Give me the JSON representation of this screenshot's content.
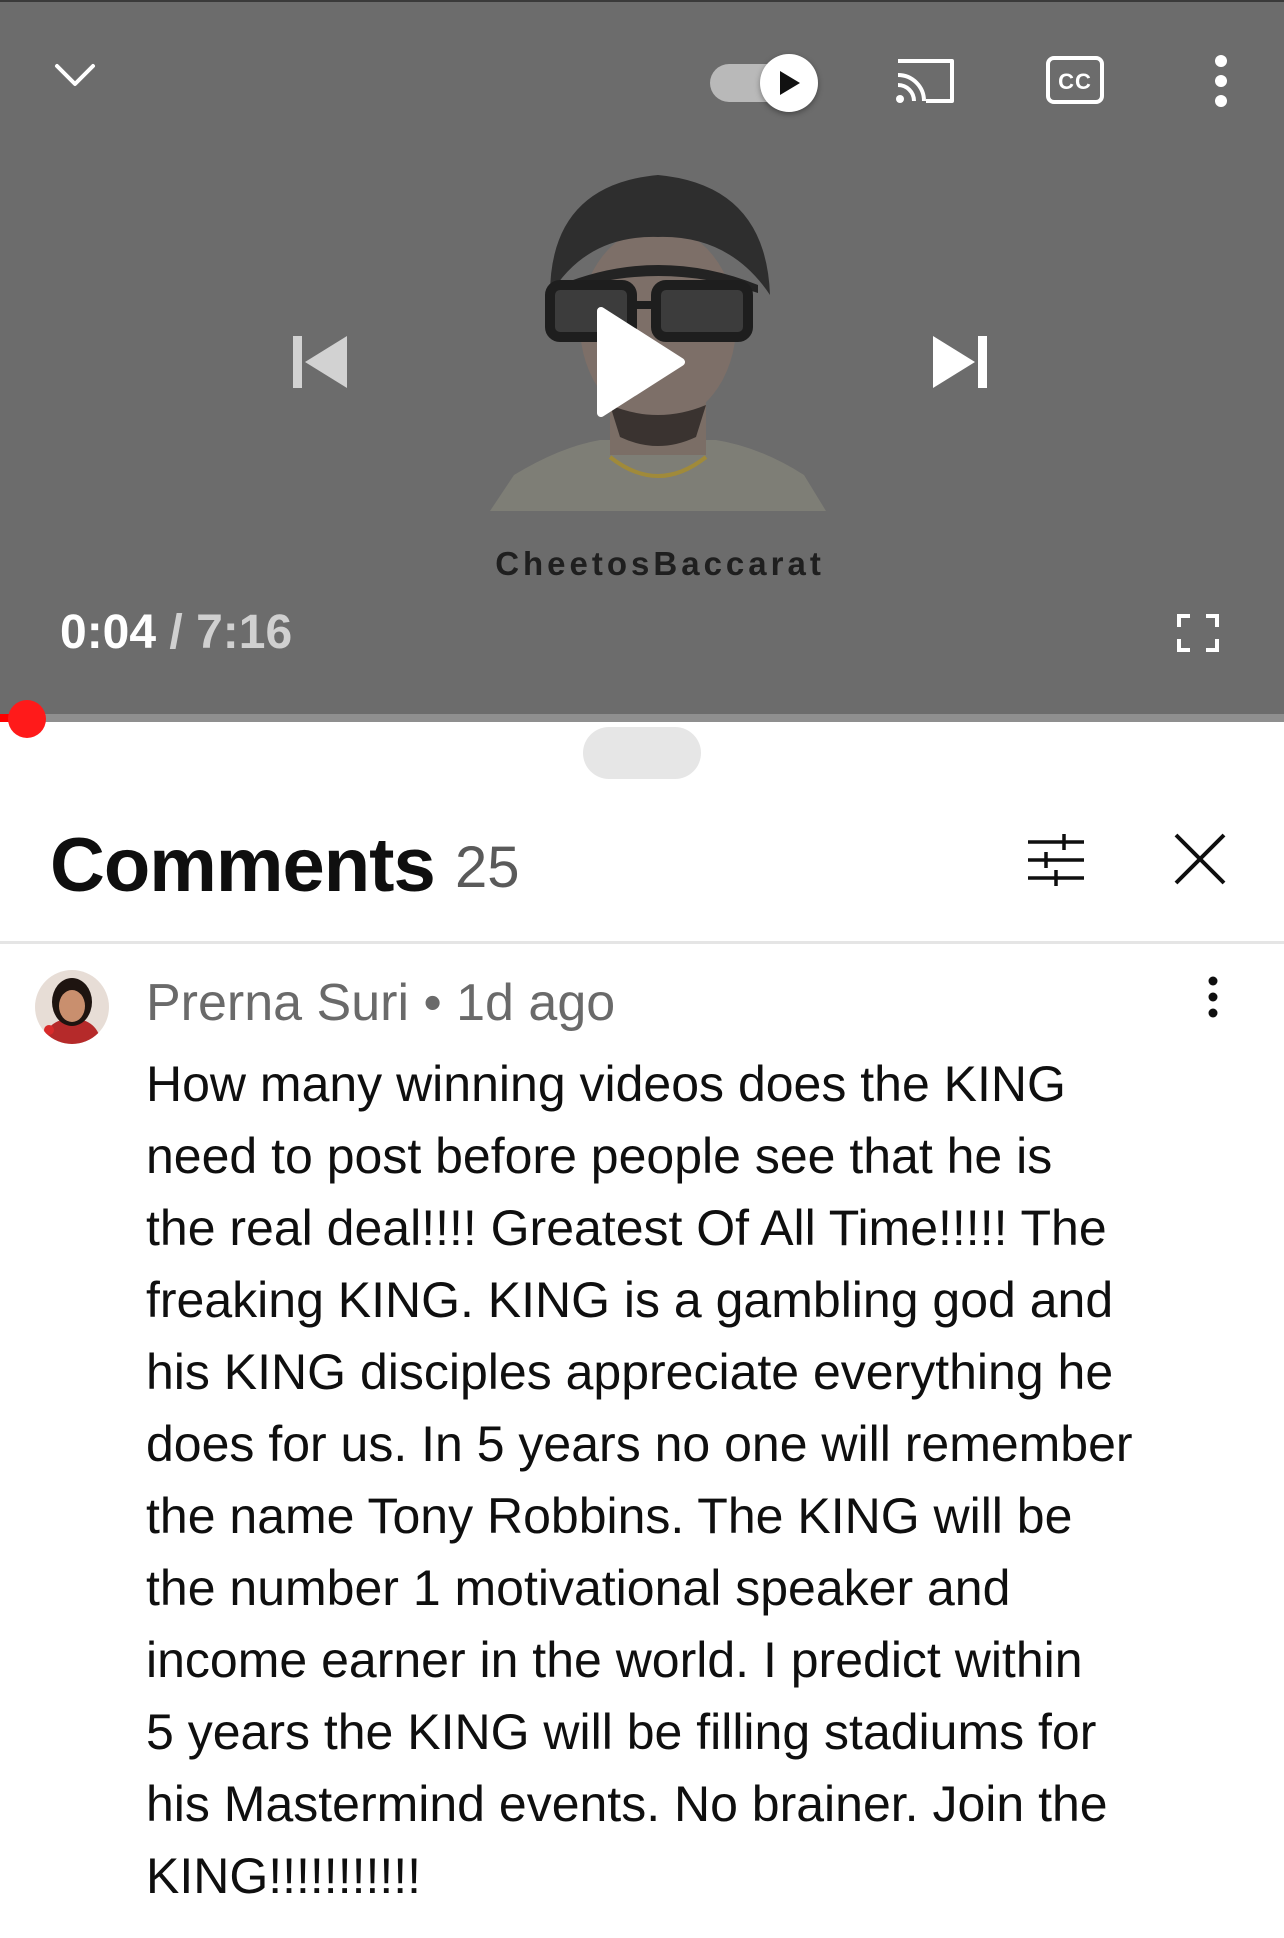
{
  "player": {
    "channel_watermark": "CheetosBaccarat",
    "current_time": "0:04",
    "duration": "7:16",
    "progress_fraction": 0.009,
    "autoplay_on": true,
    "icons": {
      "collapse": "chevron-down-icon",
      "autoplay": "autoplay-toggle",
      "cast": "cast-icon",
      "captions": "cc-icon",
      "more": "more-vert-icon",
      "previous": "skip-previous-icon",
      "play": "play-icon",
      "next": "skip-next-icon",
      "fullscreen": "fullscreen-icon"
    },
    "colors": {
      "progress": "#ff0000",
      "background": "#6c6c6c"
    }
  },
  "comments": {
    "title": "Comments",
    "count": "25",
    "items": [
      {
        "author": "Prerna Suri",
        "separator": "•",
        "age": "1d ago",
        "text": "How many winning videos does the KING\nneed to post before people see that he is\nthe real deal!!!!  Greatest Of All Time!!!!!  The\nfreaking KING. KING is a gambling god and\nhis KING disciples appreciate everything he\ndoes for us. In 5 years no one will remember\nthe name Tony Robbins. The KING will be\nthe number 1 motivational speaker and\nincome earner in the world. I predict within\n5 years the KING will be filling stadiums for\nhis Mastermind events. No brainer. Join the\nKING!!!!!!!!!!!"
      }
    ]
  }
}
